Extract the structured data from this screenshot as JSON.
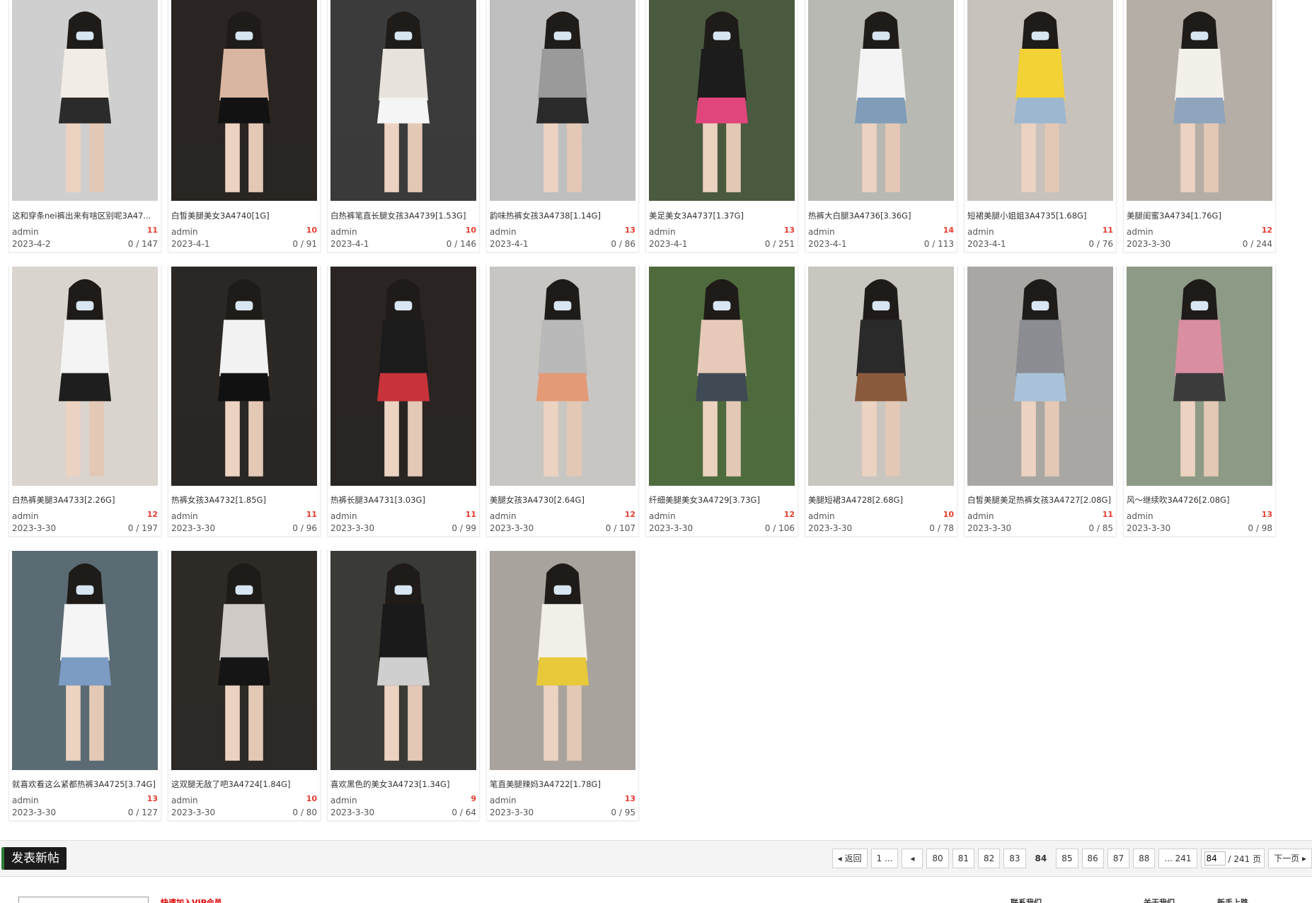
{
  "rows": [
    [
      {
        "title": "这和穿条nei裤出来有啥区别呢3A47...",
        "author": "admin",
        "date": "2023-4-2",
        "count": "11",
        "views": "0 / 147",
        "palette": [
          "#cfcfcf",
          "#f2ece6",
          "#2b2b2b"
        ]
      },
      {
        "title": "白皙美腿美女3A4740[1G]",
        "author": "admin",
        "date": "2023-4-1",
        "count": "10",
        "views": "0 / 91",
        "palette": [
          "#2a2522",
          "#d9b6a0",
          "#121212"
        ]
      },
      {
        "title": "白热裤笔直长腿女孩3A4739[1.53G]",
        "author": "admin",
        "date": "2023-4-1",
        "count": "10",
        "views": "0 / 146",
        "palette": [
          "#3b3b3b",
          "#e7e3dc",
          "#f5f5f5"
        ]
      },
      {
        "title": "韵味热裤女孩3A4738[1.14G]",
        "author": "admin",
        "date": "2023-4-1",
        "count": "13",
        "views": "0 / 86",
        "palette": [
          "#bfbfbf",
          "#9a9a9a",
          "#2a2a2a"
        ]
      },
      {
        "title": "美足美女3A4737[1.37G]",
        "author": "admin",
        "date": "2023-4-1",
        "count": "13",
        "views": "0 / 251",
        "palette": [
          "#4a5a3f",
          "#1c1c1c",
          "#e0457b"
        ]
      },
      {
        "title": "热裤大白腿3A4736[3.36G]",
        "author": "admin",
        "date": "2023-4-1",
        "count": "14",
        "views": "0 / 113",
        "palette": [
          "#b9b9b3",
          "#f4f4f4",
          "#7f9cb8"
        ]
      },
      {
        "title": "短裙美腿小姐姐3A4735[1.68G]",
        "author": "admin",
        "date": "2023-4-1",
        "count": "11",
        "views": "0 / 76",
        "palette": [
          "#c7c2bb",
          "#f2d235",
          "#9cb7cf"
        ]
      },
      {
        "title": "美腿闺蜜3A4734[1.76G]",
        "author": "admin",
        "date": "2023-3-30",
        "count": "12",
        "views": "0 / 244",
        "palette": [
          "#b5aea6",
          "#f3f0ea",
          "#8fa4bd"
        ]
      }
    ],
    [
      {
        "title": "白热裤美腿3A4733[2.26G]",
        "author": "admin",
        "date": "2023-3-30",
        "count": "12",
        "views": "0 / 197",
        "palette": [
          "#d9d4ce",
          "#f4f4f4",
          "#1e1e1e"
        ]
      },
      {
        "title": "热裤女孩3A4732[1.85G]",
        "author": "admin",
        "date": "2023-3-30",
        "count": "11",
        "views": "0 / 96",
        "palette": [
          "#2b2724",
          "#f2f2f2",
          "#111111"
        ]
      },
      {
        "title": "热裤长腿3A4731[3.03G]",
        "author": "admin",
        "date": "2023-3-30",
        "count": "11",
        "views": "0 / 99",
        "palette": [
          "#2a2522",
          "#1b1b1b",
          "#c8323a"
        ]
      },
      {
        "title": "美腿女孩3A4730[2.64G]",
        "author": "admin",
        "date": "2023-3-30",
        "count": "12",
        "views": "0 / 107",
        "palette": [
          "#c8c6c2",
          "#b9b9b9",
          "#e39a76"
        ]
      },
      {
        "title": "纤细美腿美女3A4729[3.73G]",
        "author": "admin",
        "date": "2023-3-30",
        "count": "12",
        "views": "0 / 106",
        "palette": [
          "#4f6b3e",
          "#e6c9b8",
          "#3f4a55"
        ]
      },
      {
        "title": "美腿短裙3A4728[2.68G]",
        "author": "admin",
        "date": "2023-3-30",
        "count": "10",
        "views": "0 / 78",
        "palette": [
          "#c9c5bf",
          "#2a2a2a",
          "#8a5a3c"
        ]
      },
      {
        "title": "白皙美腿美足热裤女孩3A4727[2.08G]",
        "author": "admin",
        "date": "2023-3-30",
        "count": "11",
        "views": "0 / 85",
        "palette": [
          "#a9a7a3",
          "#8b8d92",
          "#a9c2da"
        ]
      },
      {
        "title": "风～继续吹3A4726[2.08G]",
        "author": "admin",
        "date": "2023-3-30",
        "count": "13",
        "views": "0 / 98",
        "palette": [
          "#8d9a86",
          "#d98ea1",
          "#3b3b3b"
        ]
      }
    ],
    [
      {
        "title": "就喜欢看这么紧都热裤3A4725[3.74G]",
        "author": "admin",
        "date": "2023-3-30",
        "count": "13",
        "views": "0 / 127",
        "palette": [
          "#5a6b73",
          "#f5f5f5",
          "#7c9cc4"
        ]
      },
      {
        "title": "这双腿无敌了吧3A4724[1.84G]",
        "author": "admin",
        "date": "2023-3-30",
        "count": "10",
        "views": "0 / 80",
        "palette": [
          "#2e2a26",
          "#cfcac5",
          "#151515"
        ]
      },
      {
        "title": "喜欢黑色的美女3A4723[1.34G]",
        "author": "admin",
        "date": "2023-3-30",
        "count": "9",
        "views": "0 / 64",
        "palette": [
          "#3a3a36",
          "#1a1a1a",
          "#cfcfcf"
        ]
      },
      {
        "title": "笔直美腿辣妈3A4722[1.78G]",
        "author": "admin",
        "date": "2023-3-30",
        "count": "13",
        "views": "0 / 95",
        "palette": [
          "#a8a49d",
          "#f2efe9",
          "#e8c93a"
        ]
      }
    ]
  ],
  "new_post_label": "发表新帖",
  "pager": {
    "prev_label": "返回",
    "first": "1 ...",
    "pages": [
      "80",
      "81",
      "82",
      "83",
      "84",
      "85",
      "86",
      "87",
      "88"
    ],
    "current": "84",
    "last": "... 241",
    "input_value": "84",
    "total_label": "/ 241 页",
    "next_label": "下一页"
  },
  "footer": {
    "red_text": "快速加入VIP会员",
    "link1": "联系我们",
    "link2": "关于我们",
    "link3": "新手上路"
  }
}
